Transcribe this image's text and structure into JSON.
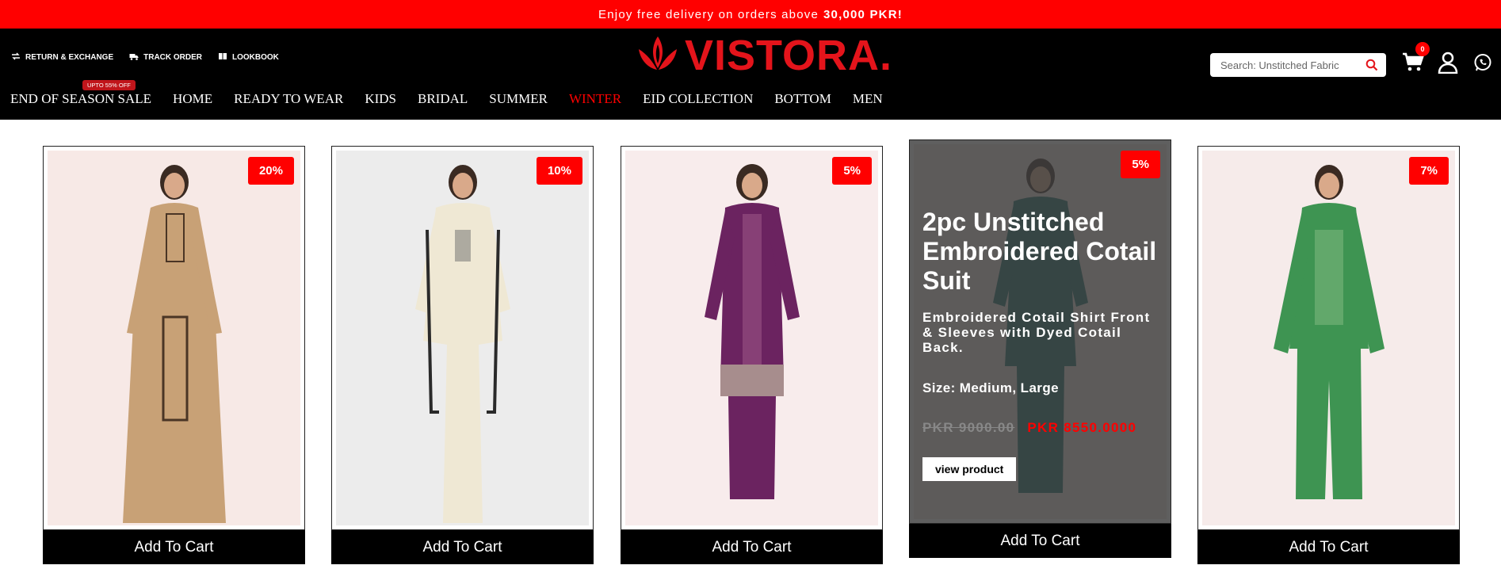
{
  "promo": {
    "text": "Enjoy free delivery on orders above",
    "amount": "30,000 PKR!"
  },
  "header": {
    "util_links": [
      {
        "label": "RETURN & EXCHANGE",
        "icon": "exchange-icon"
      },
      {
        "label": "TRACK ORDER",
        "icon": "truck-icon"
      },
      {
        "label": "LOOKBOOK",
        "icon": "book-icon"
      }
    ],
    "logo_text": "VISTORA.",
    "search": {
      "placeholder": "Search: Unstitched Fabric"
    },
    "cart_count": "0"
  },
  "nav": {
    "items": [
      {
        "label": "END OF SEASON SALE",
        "tag": "UPTO 55% OFF"
      },
      {
        "label": "HOME"
      },
      {
        "label": "READY TO WEAR"
      },
      {
        "label": "KIDS"
      },
      {
        "label": "BRIDAL"
      },
      {
        "label": "SUMMER"
      },
      {
        "label": "WINTER",
        "active": true
      },
      {
        "label": "EID COLLECTION"
      },
      {
        "label": "BOTTOM"
      },
      {
        "label": "MEN"
      }
    ]
  },
  "products": [
    {
      "discount": "20%",
      "add_label": "Add To Cart",
      "outfit": "#c8a176"
    },
    {
      "discount": "10%",
      "add_label": "Add To Cart",
      "outfit": "#efe8d4"
    },
    {
      "discount": "5%",
      "add_label": "Add To Cart",
      "outfit": "#6b2360"
    },
    {
      "discount": "5%",
      "add_label": "Add To Cart",
      "outfit": "#1f6d6a",
      "hover": {
        "title": "2pc Unstitched Embroidered Cotail Suit",
        "description": "Embroidered Cotail Shirt Front & Sleeves with Dyed Cotail Back.",
        "size": "Size: Medium, Large",
        "old_price": "PKR 9000.00",
        "new_price": "PKR 8550.0000",
        "button": "view product"
      }
    },
    {
      "discount": "7%",
      "add_label": "Add To Cart",
      "outfit": "#3e9452"
    }
  ],
  "colors": {
    "accent": "#ff0000",
    "header_bg": "#000000",
    "logo": "#e4141b"
  }
}
